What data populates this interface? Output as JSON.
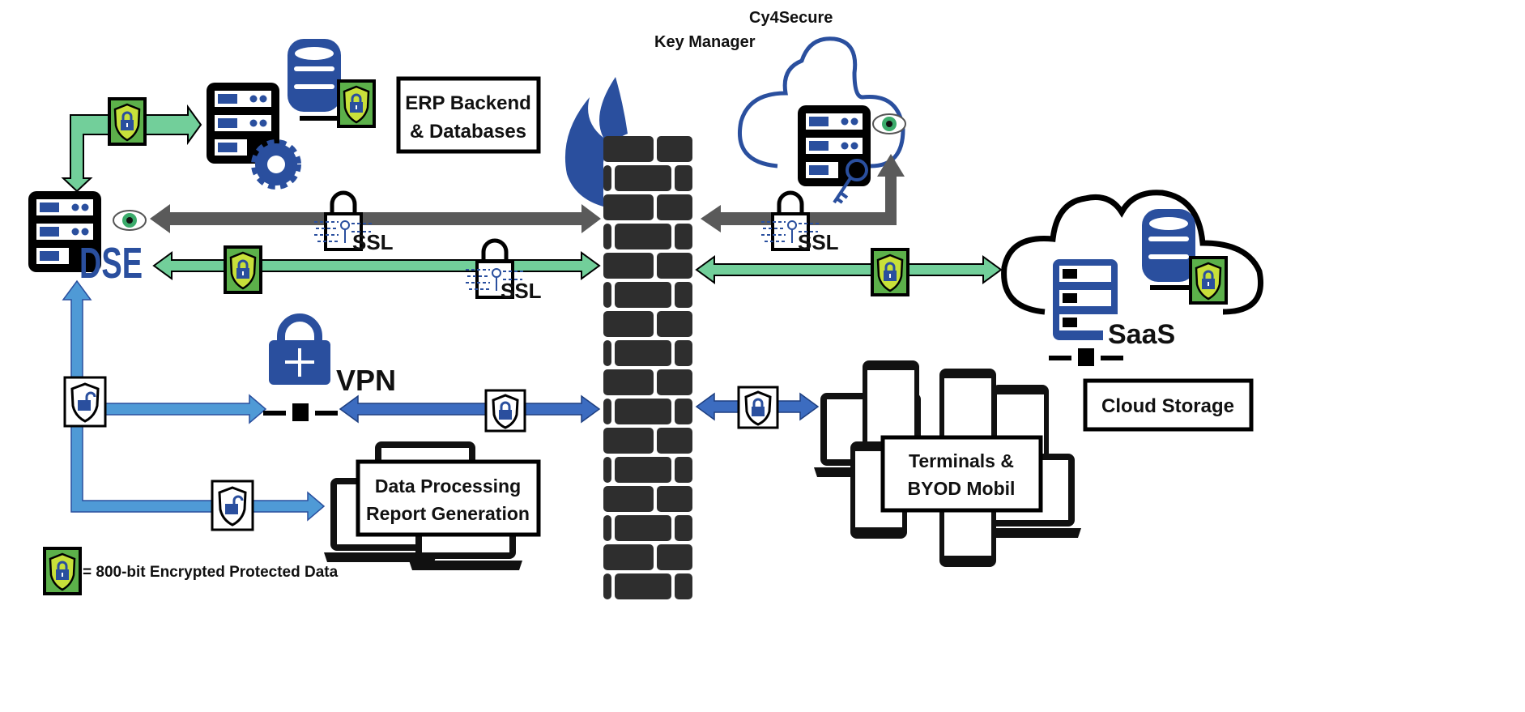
{
  "labels": {
    "erp_line1": "ERP Backend",
    "erp_line2": "& Databases",
    "key_manager_line1": "Cy4Secure",
    "key_manager_line2": "Key Manager",
    "dse": "DSE",
    "ssl": "SSL",
    "vpn": "VPN",
    "saas": "SaaS",
    "cloud_storage": "Cloud Storage",
    "data_processing_line1": "Data Processing",
    "data_processing_line2": "Report Generation",
    "terminals_line1": "Terminals &",
    "terminals_line2": "BYOD Mobil"
  },
  "legend": {
    "text": "= 800-bit Encrypted Protected Data",
    "icon": "green-shield-lock-badge"
  },
  "colors": {
    "brand_blue": "#2a4f9e",
    "green_arrow": "#72cf9a",
    "gray_arrow": "#5a5a5a",
    "blue_arrow": "#4f9ad6",
    "dark_blue_arrow": "#3c6cc0",
    "badge_green": "#5cb04a",
    "shield_yellow": "#c8e03a"
  }
}
